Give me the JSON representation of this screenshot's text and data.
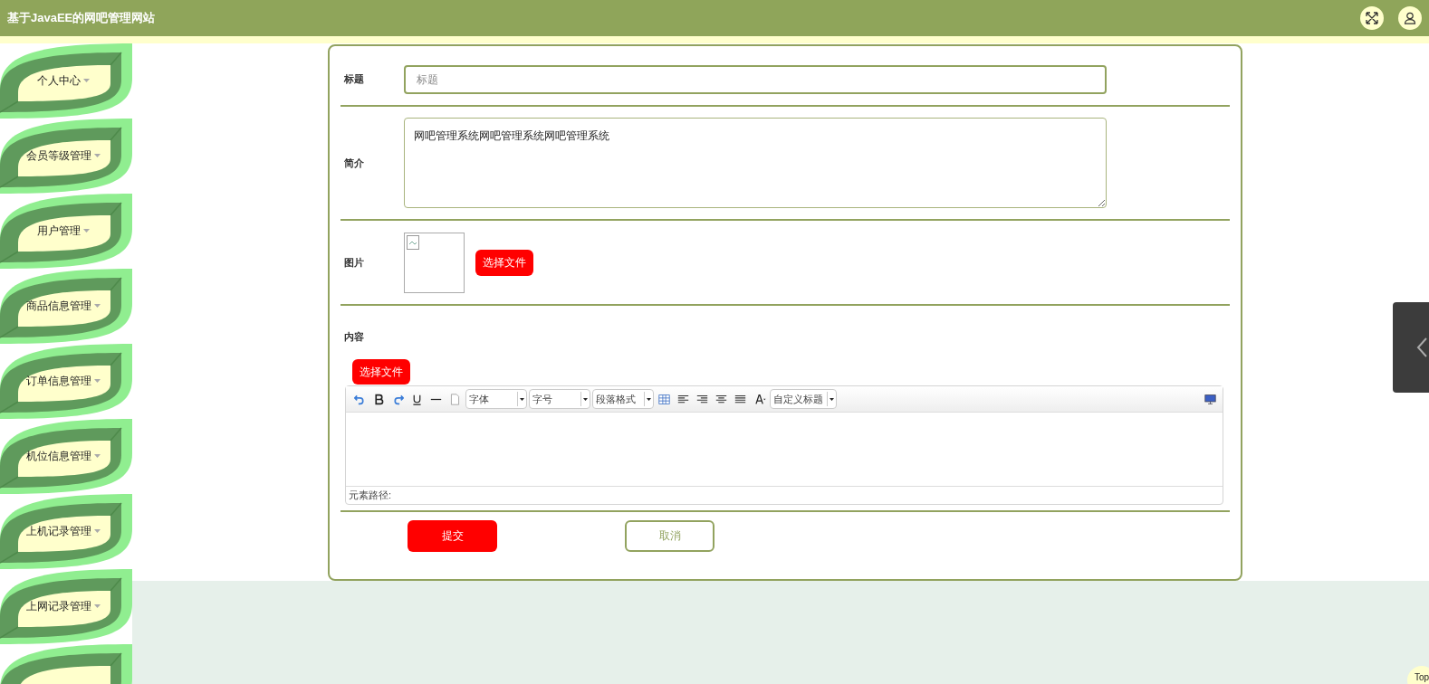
{
  "header": {
    "title": "基于JavaEE的网吧管理网站"
  },
  "sidebar": {
    "items": [
      {
        "label": "个人中心"
      },
      {
        "label": "会员等级管理"
      },
      {
        "label": "用户管理"
      },
      {
        "label": "商品信息管理"
      },
      {
        "label": "订单信息管理"
      },
      {
        "label": "机位信息管理"
      },
      {
        "label": "上机记录管理"
      },
      {
        "label": "上网记录管理"
      },
      {
        "kind": "partial"
      }
    ]
  },
  "form": {
    "title": {
      "label": "标题",
      "placeholder": "标题"
    },
    "intro": {
      "label": "简介",
      "value": "网吧管理系统网吧管理系统网吧管理系统"
    },
    "image": {
      "label": "图片",
      "button": "选择文件"
    },
    "content": {
      "label": "内容",
      "button": "选择文件",
      "toolbar": [
        {
          "kind": "undo"
        },
        {
          "kind": "bold"
        },
        {
          "kind": "redo"
        },
        {
          "kind": "underline"
        },
        {
          "kind": "hr"
        },
        {
          "kind": "page"
        },
        {
          "kind": "select",
          "text": "字体"
        },
        {
          "kind": "select",
          "text": "字号"
        },
        {
          "kind": "select",
          "text": "段落格式"
        },
        {
          "kind": "table"
        },
        {
          "kind": "align-left"
        },
        {
          "kind": "align-right"
        },
        {
          "kind": "align-center"
        },
        {
          "kind": "justify"
        },
        {
          "kind": "font-color"
        },
        {
          "kind": "select",
          "text": "自定义标题"
        },
        {
          "kind": "fullscreen"
        }
      ],
      "status": "元素路径:"
    },
    "submit": "提交",
    "cancel": "取消"
  },
  "back_to_top": "Top"
}
